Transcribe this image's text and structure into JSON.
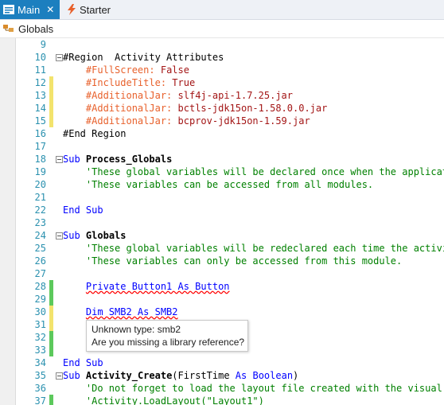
{
  "tabs": [
    {
      "label": "Main",
      "close": "✕",
      "active": true,
      "icon": "form-icon"
    },
    {
      "label": "Starter",
      "active": false,
      "icon": "lightning-icon"
    }
  ],
  "breadcrumb": {
    "label": "Globals",
    "icon": "class-icon"
  },
  "colors": {
    "accent": "#1c7fbf",
    "keyword": "#0000ff",
    "comment": "#008000",
    "string": "#a31515",
    "attribute": "#e8612c",
    "line_number": "#2b91af",
    "marker_yellow": "#f3e36d",
    "marker_green": "#5cc95c"
  },
  "code": [
    {
      "n": "9",
      "mark": "",
      "fold": false,
      "tokens": []
    },
    {
      "n": "10",
      "mark": "",
      "fold": true,
      "tokens": [
        {
          "t": "#Region  Activity Attributes",
          "c": ""
        }
      ]
    },
    {
      "n": "11",
      "mark": "",
      "fold": false,
      "tokens": [
        {
          "t": "    ",
          "c": ""
        },
        {
          "t": "#FullScreen:",
          "c": "attr"
        },
        {
          "t": " ",
          "c": ""
        },
        {
          "t": "False",
          "c": "str"
        }
      ]
    },
    {
      "n": "12",
      "mark": "yellow",
      "fold": false,
      "tokens": [
        {
          "t": "    ",
          "c": ""
        },
        {
          "t": "#IncludeTitle:",
          "c": "attr"
        },
        {
          "t": " ",
          "c": ""
        },
        {
          "t": "True",
          "c": "str"
        }
      ]
    },
    {
      "n": "13",
      "mark": "yellow",
      "fold": false,
      "tokens": [
        {
          "t": "    ",
          "c": ""
        },
        {
          "t": "#AdditionalJar:",
          "c": "attr"
        },
        {
          "t": " ",
          "c": ""
        },
        {
          "t": "slf4j-api-1.7.25.jar",
          "c": "str"
        }
      ]
    },
    {
      "n": "14",
      "mark": "yellow",
      "fold": false,
      "tokens": [
        {
          "t": "    ",
          "c": ""
        },
        {
          "t": "#AdditionalJar:",
          "c": "attr"
        },
        {
          "t": " ",
          "c": ""
        },
        {
          "t": "bctls-jdk15on-1.58.0.0.jar",
          "c": "str"
        }
      ]
    },
    {
      "n": "15",
      "mark": "yellow",
      "fold": false,
      "tokens": [
        {
          "t": "    ",
          "c": ""
        },
        {
          "t": "#AdditionalJar:",
          "c": "attr"
        },
        {
          "t": " ",
          "c": ""
        },
        {
          "t": "bcprov-jdk15on-1.59.jar",
          "c": "str"
        }
      ]
    },
    {
      "n": "16",
      "mark": "",
      "fold": false,
      "tokens": [
        {
          "t": "#End Region",
          "c": ""
        }
      ]
    },
    {
      "n": "17",
      "mark": "",
      "fold": false,
      "tokens": []
    },
    {
      "n": "18",
      "mark": "",
      "fold": true,
      "tokens": [
        {
          "t": "Sub",
          "c": "kw"
        },
        {
          "t": " ",
          "c": ""
        },
        {
          "t": "Process_Globals",
          "c": "fn"
        }
      ]
    },
    {
      "n": "19",
      "mark": "",
      "fold": false,
      "tokens": [
        {
          "t": "    ",
          "c": ""
        },
        {
          "t": "'These global variables will be declared once when the application",
          "c": "cmt"
        }
      ]
    },
    {
      "n": "20",
      "mark": "",
      "fold": false,
      "tokens": [
        {
          "t": "    ",
          "c": ""
        },
        {
          "t": "'These variables can be accessed from all modules.",
          "c": "cmt"
        }
      ]
    },
    {
      "n": "21",
      "mark": "",
      "fold": false,
      "tokens": []
    },
    {
      "n": "22",
      "mark": "",
      "fold": false,
      "tokens": [
        {
          "t": "End Sub",
          "c": "kw"
        }
      ]
    },
    {
      "n": "23",
      "mark": "",
      "fold": false,
      "tokens": []
    },
    {
      "n": "24",
      "mark": "",
      "fold": true,
      "tokens": [
        {
          "t": "Sub",
          "c": "kw"
        },
        {
          "t": " ",
          "c": ""
        },
        {
          "t": "Globals",
          "c": "fn"
        }
      ]
    },
    {
      "n": "25",
      "mark": "",
      "fold": false,
      "tokens": [
        {
          "t": "    ",
          "c": ""
        },
        {
          "t": "'These global variables will be redeclared each time the activity",
          "c": "cmt"
        }
      ]
    },
    {
      "n": "26",
      "mark": "",
      "fold": false,
      "tokens": [
        {
          "t": "    ",
          "c": ""
        },
        {
          "t": "'These variables can only be accessed from this module.",
          "c": "cmt"
        }
      ]
    },
    {
      "n": "27",
      "mark": "",
      "fold": false,
      "tokens": []
    },
    {
      "n": "28",
      "mark": "green",
      "fold": false,
      "tokens": [
        {
          "t": "    ",
          "c": ""
        },
        {
          "t": "Private Button1 As Button",
          "c": "kw sq"
        }
      ]
    },
    {
      "n": "29",
      "mark": "green",
      "fold": false,
      "tokens": []
    },
    {
      "n": "30",
      "mark": "yellow",
      "fold": false,
      "tokens": [
        {
          "t": "    ",
          "c": ""
        },
        {
          "t": "Dim SMB2 As SMB2",
          "c": "kw sq"
        }
      ]
    },
    {
      "n": "31",
      "mark": "yellow",
      "fold": false,
      "tokens": []
    },
    {
      "n": "32",
      "mark": "green",
      "fold": false,
      "tokens": []
    },
    {
      "n": "33",
      "mark": "green",
      "fold": false,
      "tokens": []
    },
    {
      "n": "34",
      "mark": "",
      "fold": false,
      "tokens": [
        {
          "t": "End Sub",
          "c": "kw"
        }
      ]
    },
    {
      "n": "35",
      "mark": "",
      "fold": true,
      "tokens": [
        {
          "t": "Sub",
          "c": "kw"
        },
        {
          "t": " ",
          "c": ""
        },
        {
          "t": "Activity_Create",
          "c": "fn"
        },
        {
          "t": "(FirstTime ",
          "c": ""
        },
        {
          "t": "As",
          "c": "kw"
        },
        {
          "t": " ",
          "c": ""
        },
        {
          "t": "Boolean",
          "c": "kw"
        },
        {
          "t": ")",
          "c": ""
        }
      ]
    },
    {
      "n": "36",
      "mark": "",
      "fold": false,
      "tokens": [
        {
          "t": "    ",
          "c": ""
        },
        {
          "t": "'Do not forget to load the layout file created with the visual de",
          "c": "cmt"
        }
      ]
    },
    {
      "n": "37",
      "mark": "green",
      "fold": false,
      "tokens": [
        {
          "t": "    ",
          "c": ""
        },
        {
          "t": "'Activity.LoadLayout(\"Layout1\")",
          "c": "cmt"
        }
      ]
    }
  ],
  "tooltip": {
    "line1": "Unknown type: smb2",
    "line2": "Are you missing a library reference?"
  }
}
